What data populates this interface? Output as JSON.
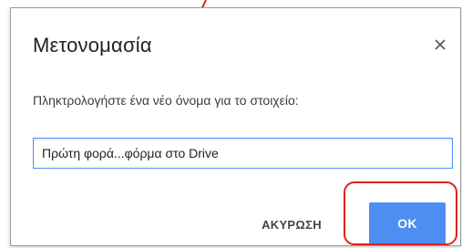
{
  "dialog": {
    "title": "Μετονομασία",
    "close_icon": "close-icon",
    "prompt": "Πληκτρολογήστε ένα νέο όνομα για το στοιχείο:",
    "input_value": "Πρώτη φορά...φόρμα στο Drive",
    "cancel_label": "ΑΚΥΡΩΣΗ",
    "ok_label": "OK"
  },
  "annotation": {
    "arrow_color": "#e02020",
    "highlight_color": "#e02020"
  },
  "colors": {
    "primary_button": "#4d8ef3",
    "input_focus_border": "#4d90fe"
  }
}
